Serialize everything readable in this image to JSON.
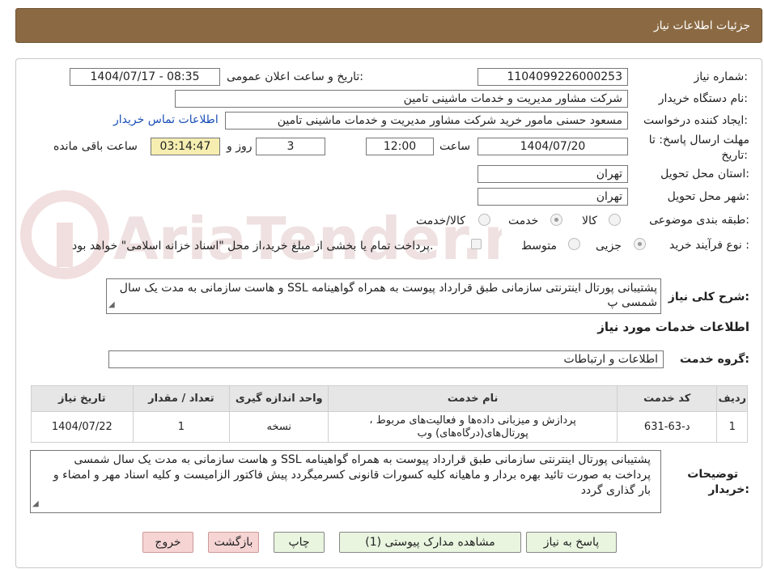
{
  "window": {
    "title": "جزئیات اطلاعات نیاز"
  },
  "form": {
    "need_number_label": "شماره نیاز:",
    "need_number": "1104099226000253",
    "announce_label": "تاریخ و ساعت اعلان عمومی:",
    "announce_value": "1404/07/17 - 08:35",
    "buyer_org_label": "نام دستگاه خریدار:",
    "buyer_org": "شرکت مشاور مدیریت و خدمات ماشینی تامین",
    "requester_label": "ایجاد کننده درخواست:",
    "requester": "مسعود حسنی مامور خرید شرکت مشاور مدیریت و خدمات ماشینی تامین",
    "buyer_contact_link": "اطلاعات تماس خریدار",
    "deadline_label_1": "مهلت ارسال پاسخ: تا",
    "deadline_label_2": "تاریخ:",
    "deadline_date": "1404/07/20",
    "time_label": "ساعت",
    "deadline_time": "12:00",
    "days_value": "3",
    "days_label": "روز و",
    "remaining_time": "03:14:47",
    "remaining_label": "ساعت باقی مانده",
    "province_label": "استان محل تحویل:",
    "province": "تهران",
    "city_label": "شهر محل تحویل:",
    "city": "تهران",
    "category_label": "طبقه بندی موضوعی:",
    "category_options": [
      "کالا",
      "خدمت",
      "کالا/خدمت"
    ],
    "category_selected": "خدمت",
    "process_label": "نوع فرآیند خرید :",
    "process_options": [
      "جزیی",
      "متوسط"
    ],
    "process_selected": "جزیی",
    "payment_note": "پرداخت تمام یا بخشی از مبلغ خرید،از محل \"اسناد خزانه اسلامی\" خواهد بود."
  },
  "summary": {
    "label": "شرح کلی نیاز:",
    "text": "پشتیبانی پورتال اینترنتی   سازمانی طبق قرارداد پیوست   به همراه گواهینامه SSL و هاست سازمانی به مدت یک سال شمسی  پ"
  },
  "services_section": {
    "heading": "اطلاعات خدمات مورد نیاز",
    "group_label": "گروه خدمت:",
    "group_value": "اطلاعات و ارتباطات"
  },
  "table": {
    "headers": [
      "ردیف",
      "کد خدمت",
      "نام خدمت",
      "واحد اندازه گیری",
      "تعداد / مقدار",
      "تاریخ نیاز"
    ],
    "rows": [
      [
        "1",
        "د-63-631",
        "پردازش و میزبانی داده‌ها و فعالیت‌های مربوط ، پورتال‌های(درگاه‌های) وب",
        "نسخه",
        "1",
        "1404/07/22"
      ]
    ]
  },
  "buyer_notes": {
    "label_1": "توضیحات",
    "label_2": "خریدار:",
    "text": "پشتیبانی پورتال اینترنتی   سازمانی طبق قرارداد پیوست   به همراه گواهینامه SSL و هاست سازمانی به مدت یک سال شمسی  پرداخت به صورت تائید بهره بردار و ماهیانه کلیه کسورات قانونی کسرمیگردد پیش فاکتور الزامیست و کلیه اسناد مهر و امضاء و بار گذاری گردد"
  },
  "buttons": {
    "reply": "پاسخ به نیاز",
    "attachments": "مشاهده مدارک پیوستی (1)",
    "print": "چاپ",
    "back": "بازگشت",
    "exit": "خروج"
  },
  "watermark": {
    "text": "AriaTender.neT",
    "color": "#d9b8b8"
  }
}
